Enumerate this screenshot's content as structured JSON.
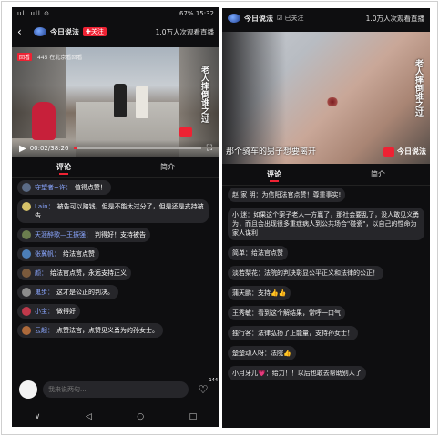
{
  "left": {
    "status": {
      "signal": "ull ull ⊙",
      "battery": "67%",
      "time": "15:32"
    },
    "header": {
      "back_icon": "back-arrow-icon",
      "channel": "今日说法",
      "follow": "✚关注",
      "viewers": "1.0万人次观看直播"
    },
    "video": {
      "tag": "回看",
      "top_caption": "445 在北京看回看",
      "vertical_title": "老人摔倒谁之过",
      "time": "00:02/38:26",
      "progress_pct": 2
    },
    "tabs": [
      "评论",
      "简介"
    ],
    "comments": [
      {
        "user": "守望者~许：",
        "text": "值得点赞！",
        "color": "#5b6b86"
      },
      {
        "user": "Lain：",
        "text": "被告可以赔钱，但是不能太过分了，但是还是支持被告",
        "color": "#d7c36a"
      },
      {
        "user": "天涯醉歌—王振强：",
        "text": "判得好！支持被告",
        "color": "#6b7d4e"
      },
      {
        "user": "张冀帆：",
        "text": "给法官点赞",
        "color": "#4c7fb8"
      },
      {
        "user": "颜：",
        "text": "给法官点赞，永远支持正义",
        "color": "#7a5a3c"
      },
      {
        "user": "鬼步：",
        "text": "这才是公正的判决。",
        "color": "#8c8c8c"
      },
      {
        "user": "小宝：",
        "text": "做得好",
        "color": "#c0394b"
      },
      {
        "user": "云起：",
        "text": "点赞法官，点赞见义勇为的孙女士。",
        "color": "#ad6a3b"
      }
    ],
    "input_placeholder": "我来说两句...",
    "like_count": "144",
    "nav": [
      "∨",
      "◁",
      "○",
      "□"
    ]
  },
  "right": {
    "header": {
      "channel": "今日说法",
      "follow": "已关注",
      "viewers": "1.0万人次观看直播"
    },
    "video": {
      "vertical_title": "老人摔倒谁之过",
      "caption": "那个骑车的男子想要离开",
      "brand": "今日说法"
    },
    "tabs": [
      "评论",
      "简介"
    ],
    "comments": [
      {
        "user": "赵 家 明：",
        "text": "为信阳法官点赞！尊重事实!",
        "color": "#e3b43d"
      },
      {
        "user": "小 迷：",
        "text": "如果这个案子老人一方赢了，那社会要乱了，没人敢见义勇为，而且会出现很多重症病人到公共场合\"碰瓷\"，以自己的性命为家人谋利",
        "color": "#9a9a9a"
      },
      {
        "user": "简单：",
        "text": "给法官点赞",
        "color": "#7b7b7b"
      },
      {
        "user": "淡若梨花：",
        "text": "法院的判决彰显公平正义和法律的公正！",
        "color": "#c9a58a"
      },
      {
        "user": "蒲天鹏：",
        "text": "支持👍👍",
        "color": "#5e8f6b"
      },
      {
        "user": "王秀敏：",
        "text": "看到这个解结果，常呼一口气",
        "color": "#b25c5c"
      },
      {
        "user": "独行客：",
        "text": "法律弘扬了正能量，支持孙女士！",
        "color": "#6e6e6e"
      },
      {
        "user": "楚楚动人呀：",
        "text": "法院👍",
        "color": "#c47ea1"
      },
      {
        "user": "小月牙儿💗：",
        "text": "给力！！以后也敢去帮助别人了",
        "color": "#d5b7a0"
      }
    ]
  }
}
